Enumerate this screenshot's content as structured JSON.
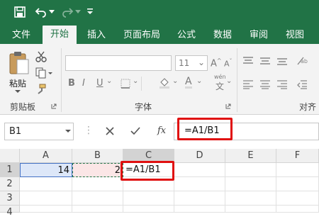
{
  "tabs": [
    "文件",
    "开始",
    "插入",
    "页面布局",
    "公式",
    "数据",
    "审阅",
    "视图"
  ],
  "ribbon": {
    "paste_label": "粘贴",
    "clipboard_group": "剪贴板",
    "font_group": "字体",
    "align_group": "对齐方",
    "font_size": "11",
    "wen_label": "wén",
    "wen_char": "文"
  },
  "formula_bar": {
    "name_box": "B1",
    "formula": "=A1/B1",
    "fx_label": "fx"
  },
  "columns": [
    "A",
    "B",
    "C",
    "D",
    "E",
    "F"
  ],
  "rows": [
    "1",
    "2",
    "3",
    "4"
  ],
  "cells": {
    "A1": "14",
    "B1": "2",
    "C1": "=A1/B1"
  },
  "colors": {
    "brand": "#217346",
    "highlight": "#e01010"
  }
}
